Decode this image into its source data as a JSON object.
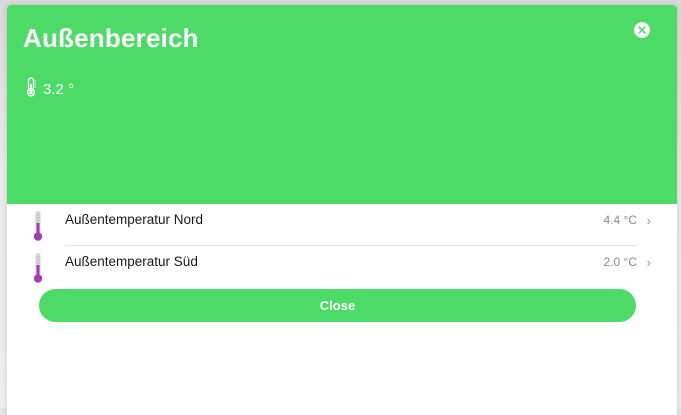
{
  "dialog": {
    "title": "Außenbereich",
    "header_temperature": "3.2 °",
    "accent_color": "#4ddb68",
    "close_button_label": "Close"
  },
  "sensors": [
    {
      "label": "Außentemperatur Nord",
      "value": "4.4 °C",
      "icon": "thermometer-icon"
    },
    {
      "label": "Außentemperatur Süd",
      "value": "2.0 °C",
      "icon": "thermometer-icon"
    }
  ]
}
